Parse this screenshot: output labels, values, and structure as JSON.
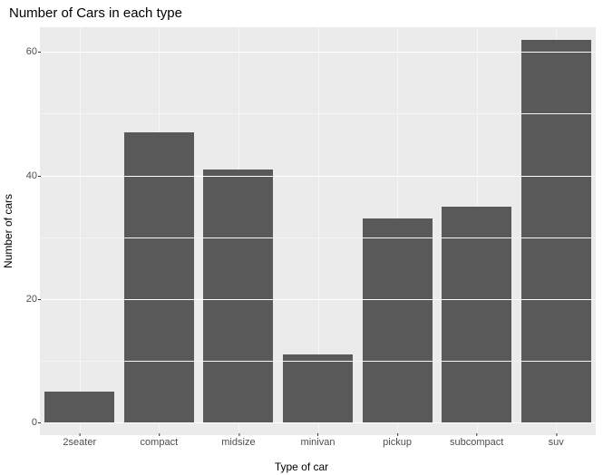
{
  "chart_data": {
    "type": "bar",
    "title": "Number of Cars in each type",
    "xlabel": "Type of car",
    "ylabel": "Number of cars",
    "categories": [
      "2seater",
      "compact",
      "midsize",
      "minivan",
      "pickup",
      "subcompact",
      "suv"
    ],
    "values": [
      5,
      47,
      41,
      11,
      33,
      35,
      62
    ],
    "ylim": [
      -2,
      64
    ],
    "yticks": [
      0,
      20,
      40,
      60
    ],
    "yminor": [
      10,
      30,
      50
    ],
    "bar_fill": "#595959",
    "panel_bg": "#ebebeb"
  }
}
